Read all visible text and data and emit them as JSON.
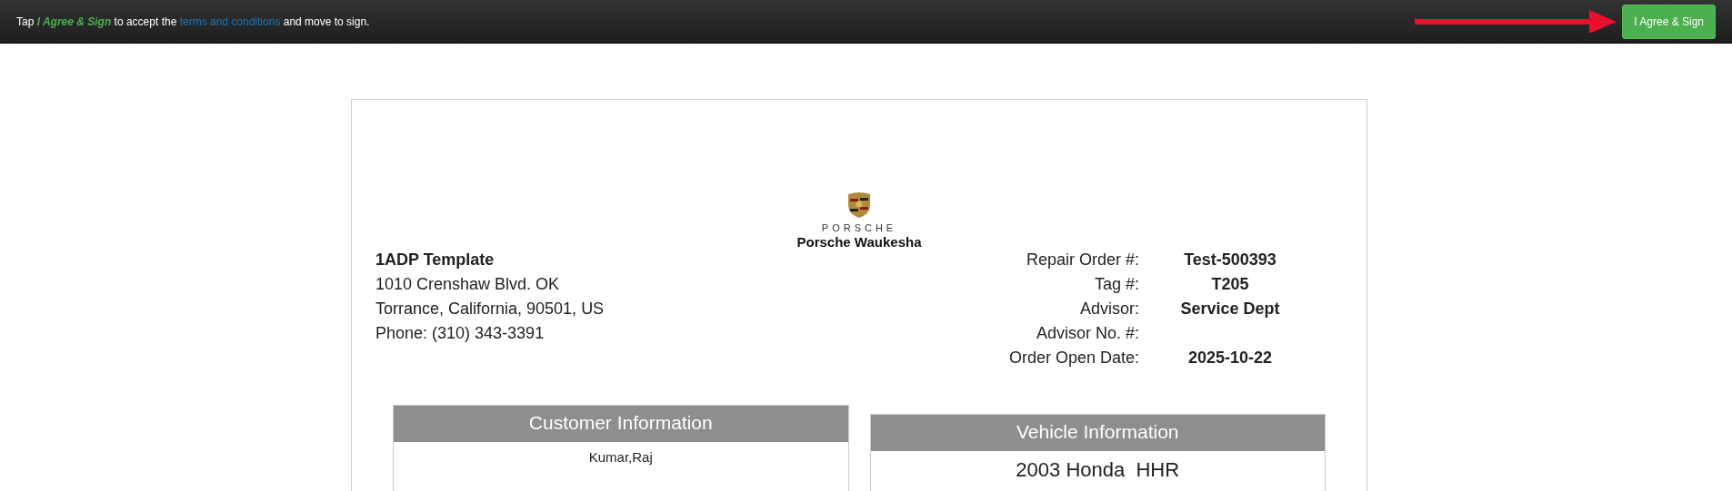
{
  "top_bar": {
    "instruction": {
      "before": "Tap",
      "highlight": "I Agree & Sign",
      "middle": "to accept the",
      "link": "terms and conditions",
      "after": "and move to sign."
    },
    "button": "I Agree & Sign"
  },
  "document": {
    "logo": {
      "wordmark": "PORSCHE",
      "dealer": "Porsche Waukesha"
    },
    "dealer_address": [
      "1ADP Template",
      "1010 Crenshaw Blvd. OK",
      "Torrance, California, 90501, US",
      "Phone: (310) 343-3391"
    ],
    "order_fields": [
      {
        "label": "Repair Order #:",
        "value": "Test-500393"
      },
      {
        "label": "Tag #:",
        "value": "T205"
      },
      {
        "label": "Advisor:",
        "value": "Service Dept"
      },
      {
        "label": "Advisor No. #:"
      },
      {
        "label": "Order Open Date:",
        "value": "2025-10-22"
      }
    ],
    "sections": [
      {
        "title": "Customer Information",
        "lines": [
          "Kumar,Raj"
        ]
      },
      {
        "title": "Vehicle Information",
        "lines": [
          "2003 Honda  HHR"
        ]
      }
    ]
  }
}
